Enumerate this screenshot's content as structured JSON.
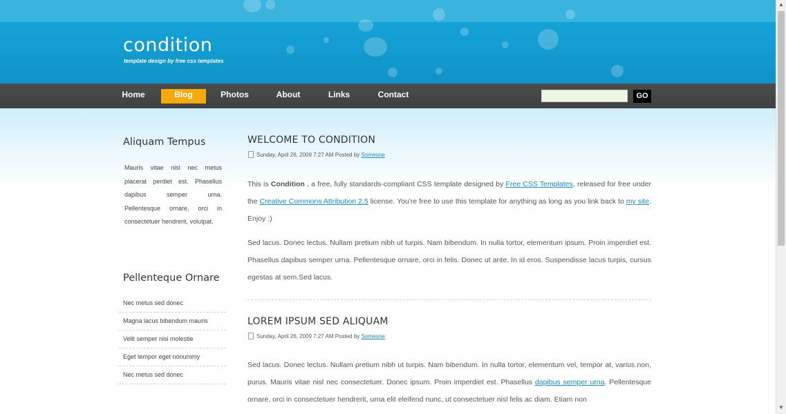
{
  "header": {
    "logo": "condition",
    "tagline": "template design by free css templates"
  },
  "nav": {
    "items": [
      {
        "label": "Home"
      },
      {
        "label": "Blog"
      },
      {
        "label": "Photos"
      },
      {
        "label": "About"
      },
      {
        "label": "Links"
      },
      {
        "label": "Contact"
      }
    ],
    "active": "Blog",
    "search_value": "",
    "go_label": "GO"
  },
  "sidebar": {
    "box1_title": "Aliquam Tempus",
    "box1_text": "Mauris vitae nisl nec metus placerat perdiet est. Phasellus dapibus semper urna. Pellentesque ornare, orci in consectetuer hendrerit, volutpat.",
    "box2_title": "Pellenteque Ornare",
    "links": [
      "Nec metus sed donec",
      "Magna lacus bibendum mauris",
      "Velit semper nisi molestie",
      "Eget tempor eget nonummy",
      "Nec metus sed donec"
    ]
  },
  "posts": [
    {
      "title": "WELCOME TO CONDITION",
      "meta_date": "Sunday, April 26, 2009 7:27 AM Posted by",
      "meta_author": "Someone",
      "p1_a": "This is ",
      "p1_b": "Condition",
      "p1_c": " , a free, fully standards-compliant CSS template designed by ",
      "p1_link1": "Free CSS Templates",
      "p1_d": ", released for free under the ",
      "p1_link2": "Creative Commons Attribution 2.5",
      "p1_e": " license. You're free to use this template for anything as long as you link back to ",
      "p1_link3": "my site",
      "p1_f": ". Enjoy :)",
      "p2": "Sed lacus. Donec lectus. Nullam pretium nibh ut turpis. Nam bibendum. In nulla tortor, elementum ipsum. Proin imperdiet est. Phasellus dapibus semper urna. Pellentesque ornare, orci in felis. Donec ut ante. In id eros. Suspendisse lacus turpis, cursus egestas at sem.Sed lacus."
    },
    {
      "title": "LOREM IPSUM SED ALIQUAM",
      "meta_date": "Sunday, April 26, 2009 7:27 AM Posted by",
      "meta_author": "Someone",
      "p1_a": "Sed lacus. Donec lectus. Nullam pretium nibh ut turpis. Nam bibendum. In nulla tortor, elementum vel, tempor at, varius non, purus. Mauris vitae nisl nec consectetuer. Donec ipsum. Proin imperdiet est. Phasellus ",
      "p1_link1": "dapibus semper urna",
      "p1_b": ". Pellentesque ornare, orci in consectetuer hendrerit, urna elit eleifend nunc, ut consectetuer nisl felis ac diam. Etiam non"
    }
  ],
  "colors": {
    "header_blue": "#15a3d7",
    "nav_dark": "#434647",
    "active_orange": "#f6a90b",
    "link_blue": "#1a8ab7"
  }
}
